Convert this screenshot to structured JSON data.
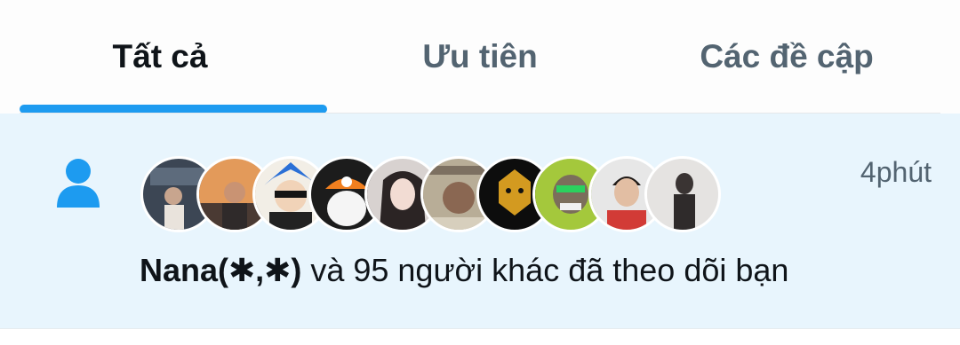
{
  "tabs": [
    {
      "label": "Tất cả",
      "active": true
    },
    {
      "label": "Ưu tiên",
      "active": false
    },
    {
      "label": "Các đề cập",
      "active": false
    }
  ],
  "accent_color": "#1d9bf0",
  "notification": {
    "icon": "person-icon",
    "time": "4phút",
    "actor_name": "Nana(✱,✱)",
    "message_rest": " và 95 người khác đã theo dõi bạn",
    "avatar_count": 10
  }
}
